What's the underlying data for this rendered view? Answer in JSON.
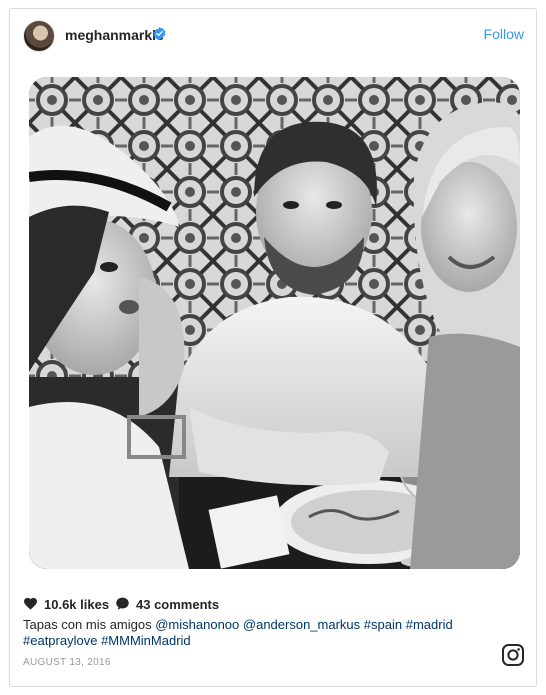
{
  "post": {
    "username": "meghanmarkle",
    "verified_icon": "verified-badge-icon",
    "follow_label": "Follow",
    "photo_description_icon": "post-photo",
    "likes": "10.6k likes",
    "comments": "43 comments",
    "caption": {
      "text_before": "Tapas con mis amigos ",
      "mention_1": "@mishanonoo",
      "mention_2": "@anderson_markus",
      "tag_1": "#spain",
      "tag_2": "#madrid",
      "tag_3": "#eatpraylove",
      "tag_4": "#MMMinMadrid"
    },
    "date": "AUGUST 13, 2016"
  },
  "colors": {
    "accent": "#3897f0",
    "text": "#262626",
    "muted": "#999999",
    "border": "#dbdbdb",
    "verified": "#3897f0"
  }
}
